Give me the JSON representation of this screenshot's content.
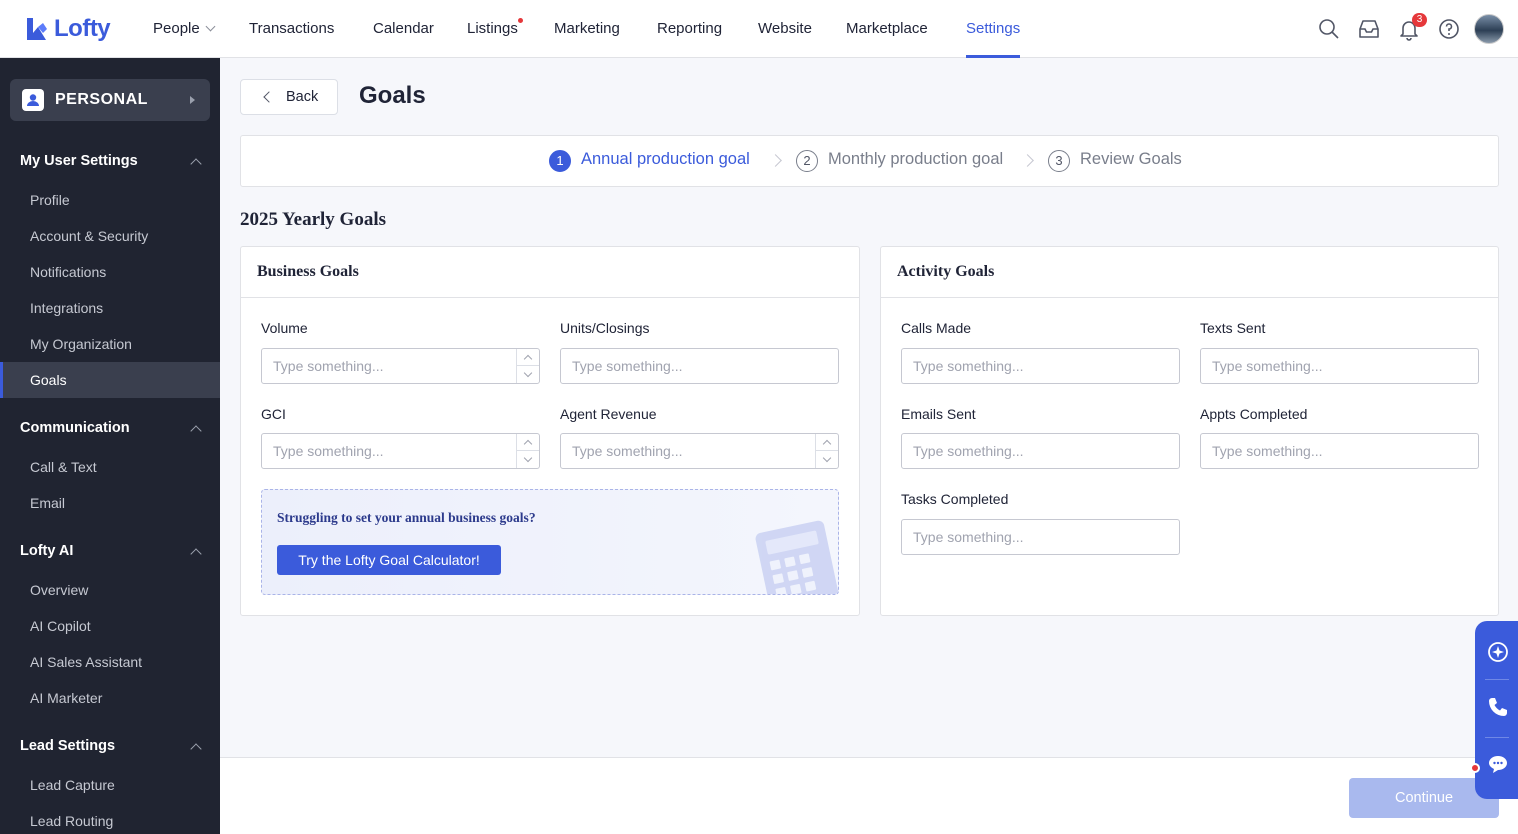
{
  "app": {
    "logo_text": "Lofty"
  },
  "nav": {
    "items": [
      "People",
      "Transactions",
      "Calendar",
      "Listings",
      "Marketing",
      "Reporting",
      "Website",
      "Marketplace",
      "Settings"
    ],
    "active": "Settings",
    "notifications_count": "3"
  },
  "sidebar": {
    "switcher_label": "PERSONAL",
    "sections": [
      {
        "title": "My User Settings",
        "items": [
          "Profile",
          "Account & Security",
          "Notifications",
          "Integrations",
          "My Organization",
          "Goals"
        ]
      },
      {
        "title": "Communication",
        "items": [
          "Call & Text",
          "Email"
        ]
      },
      {
        "title": "Lofty AI",
        "items": [
          "Overview",
          "AI Copilot",
          "AI Sales Assistant",
          "AI Marketer"
        ]
      },
      {
        "title": "Lead Settings",
        "items": [
          "Lead Capture",
          "Lead Routing"
        ]
      }
    ],
    "active_item": "Goals"
  },
  "page": {
    "back_label": "Back",
    "title": "Goals",
    "steps": [
      {
        "num": "1",
        "label": "Annual production goal",
        "active": true
      },
      {
        "num": "2",
        "label": "Monthly production goal",
        "active": false
      },
      {
        "num": "3",
        "label": "Review Goals",
        "active": false
      }
    ],
    "year_title": "2025 Yearly Goals"
  },
  "business_goals": {
    "title": "Business Goals",
    "fields": [
      {
        "label": "Volume",
        "placeholder": "Type something..."
      },
      {
        "label": "Units/Closings",
        "placeholder": "Type something..."
      },
      {
        "label": "GCI",
        "placeholder": "Type something..."
      },
      {
        "label": "Agent Revenue",
        "placeholder": "Type something..."
      }
    ],
    "calculator": {
      "prompt": "Struggling to set your annual business goals?",
      "button_label": "Try the Lofty Goal Calculator!"
    }
  },
  "activity_goals": {
    "title": "Activity Goals",
    "fields": [
      {
        "label": "Calls Made",
        "placeholder": "Type something..."
      },
      {
        "label": "Texts Sent",
        "placeholder": "Type something..."
      },
      {
        "label": "Emails Sent",
        "placeholder": "Type something..."
      },
      {
        "label": "Appts Completed",
        "placeholder": "Type something..."
      },
      {
        "label": "Tasks Completed",
        "placeholder": "Type something..."
      }
    ]
  },
  "footer": {
    "continue_label": "Continue"
  },
  "colors": {
    "accent": "#3b5bdb",
    "sidebar_bg": "#202431",
    "badge": "#e5383b"
  },
  "icons": [
    "search-icon",
    "inbox-icon",
    "bell-icon",
    "help-icon",
    "ai-icon",
    "phone-icon",
    "chat-icon"
  ]
}
